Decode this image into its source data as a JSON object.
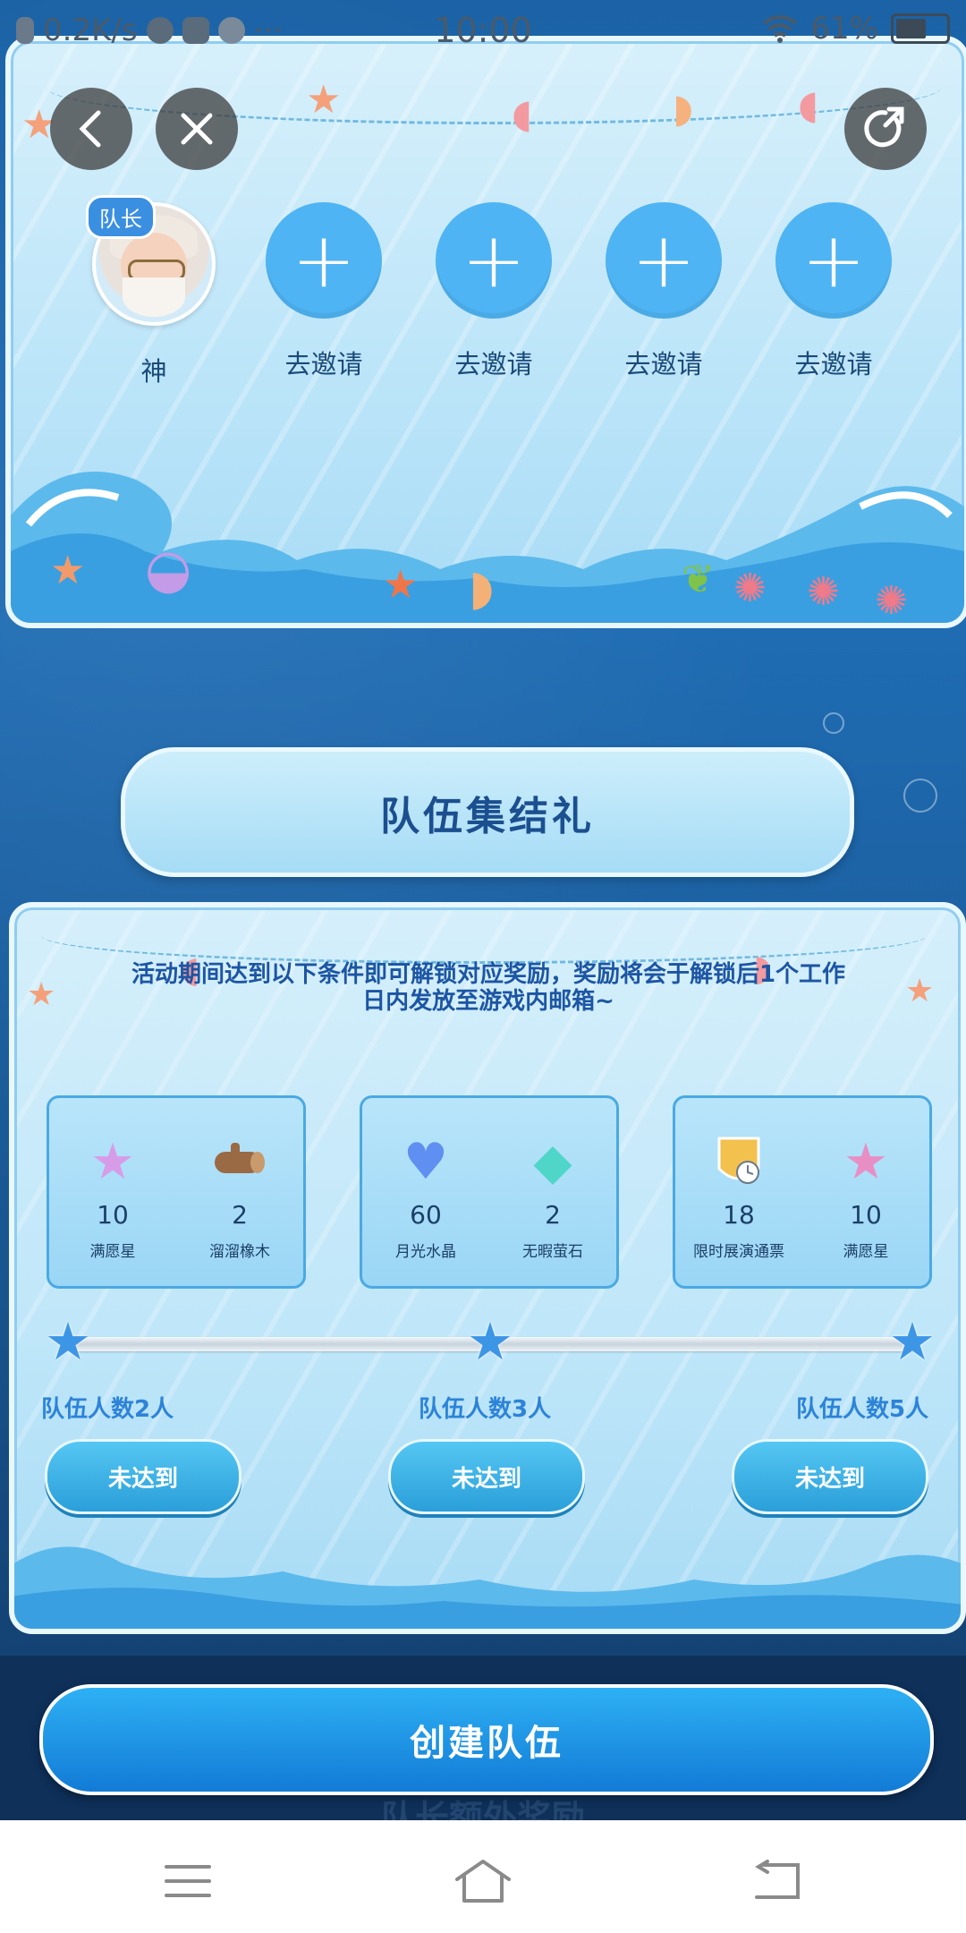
{
  "status_bar": {
    "network_speed": "0.2K/s",
    "time": "10:00",
    "battery": "61%",
    "battery_level": 0.61
  },
  "top_bar": {
    "back_icon": "chevron-left-icon",
    "close_icon": "close-icon",
    "share_icon": "share-icon"
  },
  "team": {
    "leader_badge": "队长",
    "members": [
      {
        "label": "神",
        "type": "leader"
      },
      {
        "label": "去邀请",
        "type": "invite"
      },
      {
        "label": "去邀请",
        "type": "invite"
      },
      {
        "label": "去邀请",
        "type": "invite"
      },
      {
        "label": "去邀请",
        "type": "invite"
      }
    ]
  },
  "section_title": "队伍集结礼",
  "notice": "活动期间达到以下条件即可解锁对应奖励，奖励将会于解锁后1个工作日内发放至游戏内邮箱~",
  "tiers": [
    {
      "label": "队伍人数2人",
      "status": "未达到",
      "rewards": [
        {
          "count": "10",
          "name": "满愿星",
          "icon": "pink-star-icon"
        },
        {
          "count": "2",
          "name": "溜溜橡木",
          "icon": "wood-log-icon"
        }
      ]
    },
    {
      "label": "队伍人数3人",
      "status": "未达到",
      "rewards": [
        {
          "count": "60",
          "name": "月光水晶",
          "icon": "crystal-heart-icon"
        },
        {
          "count": "2",
          "name": "无暇萤石",
          "icon": "gem-icon"
        }
      ]
    },
    {
      "label": "队伍人数5人",
      "status": "未达到",
      "rewards": [
        {
          "count": "18",
          "name": "限时展演通票",
          "icon": "ticket-badge-icon"
        },
        {
          "count": "10",
          "name": "满愿星",
          "icon": "pink-star-icon"
        }
      ]
    }
  ],
  "create_button": "创建队伍",
  "next_section_title": "队长额外奖励",
  "colors": {
    "accent_blue": "#2c83d8",
    "invite_blue": "#4fb4f3",
    "title_text": "#1c4f8f"
  }
}
